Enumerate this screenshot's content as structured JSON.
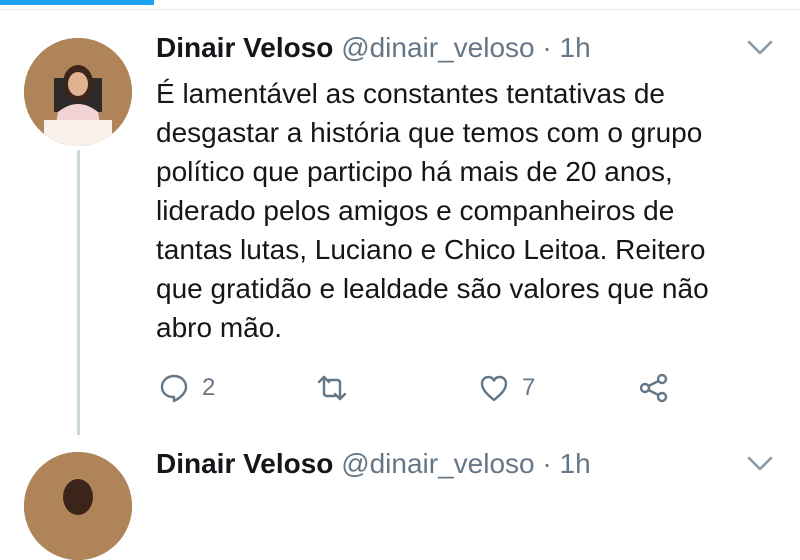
{
  "tweets": [
    {
      "author_name": "Dinair Veloso",
      "handle": "@dinair_veloso",
      "separator": "·",
      "time": "1h",
      "text": "É lamentável as constantes tentativas de desgastar a história que temos com o grupo político que participo há mais de 20 anos, liderado pelos amigos e companheiros de tantas lutas, Luciano e Chico Leitoa. Reitero que gratidão e lealdade são valores que não abro mão.",
      "reply_count": "2",
      "retweet_count": "",
      "like_count": "7"
    },
    {
      "author_name": "Dinair Veloso",
      "handle": "@dinair_veloso",
      "separator": "·",
      "time": "1h"
    }
  ],
  "colors": {
    "accent": "#1da1f2",
    "secondary_text": "#657786",
    "thread_line": "#ccd6dd"
  },
  "icons": [
    "reply-icon",
    "retweet-icon",
    "like-icon",
    "share-icon",
    "chevron-down-icon"
  ]
}
